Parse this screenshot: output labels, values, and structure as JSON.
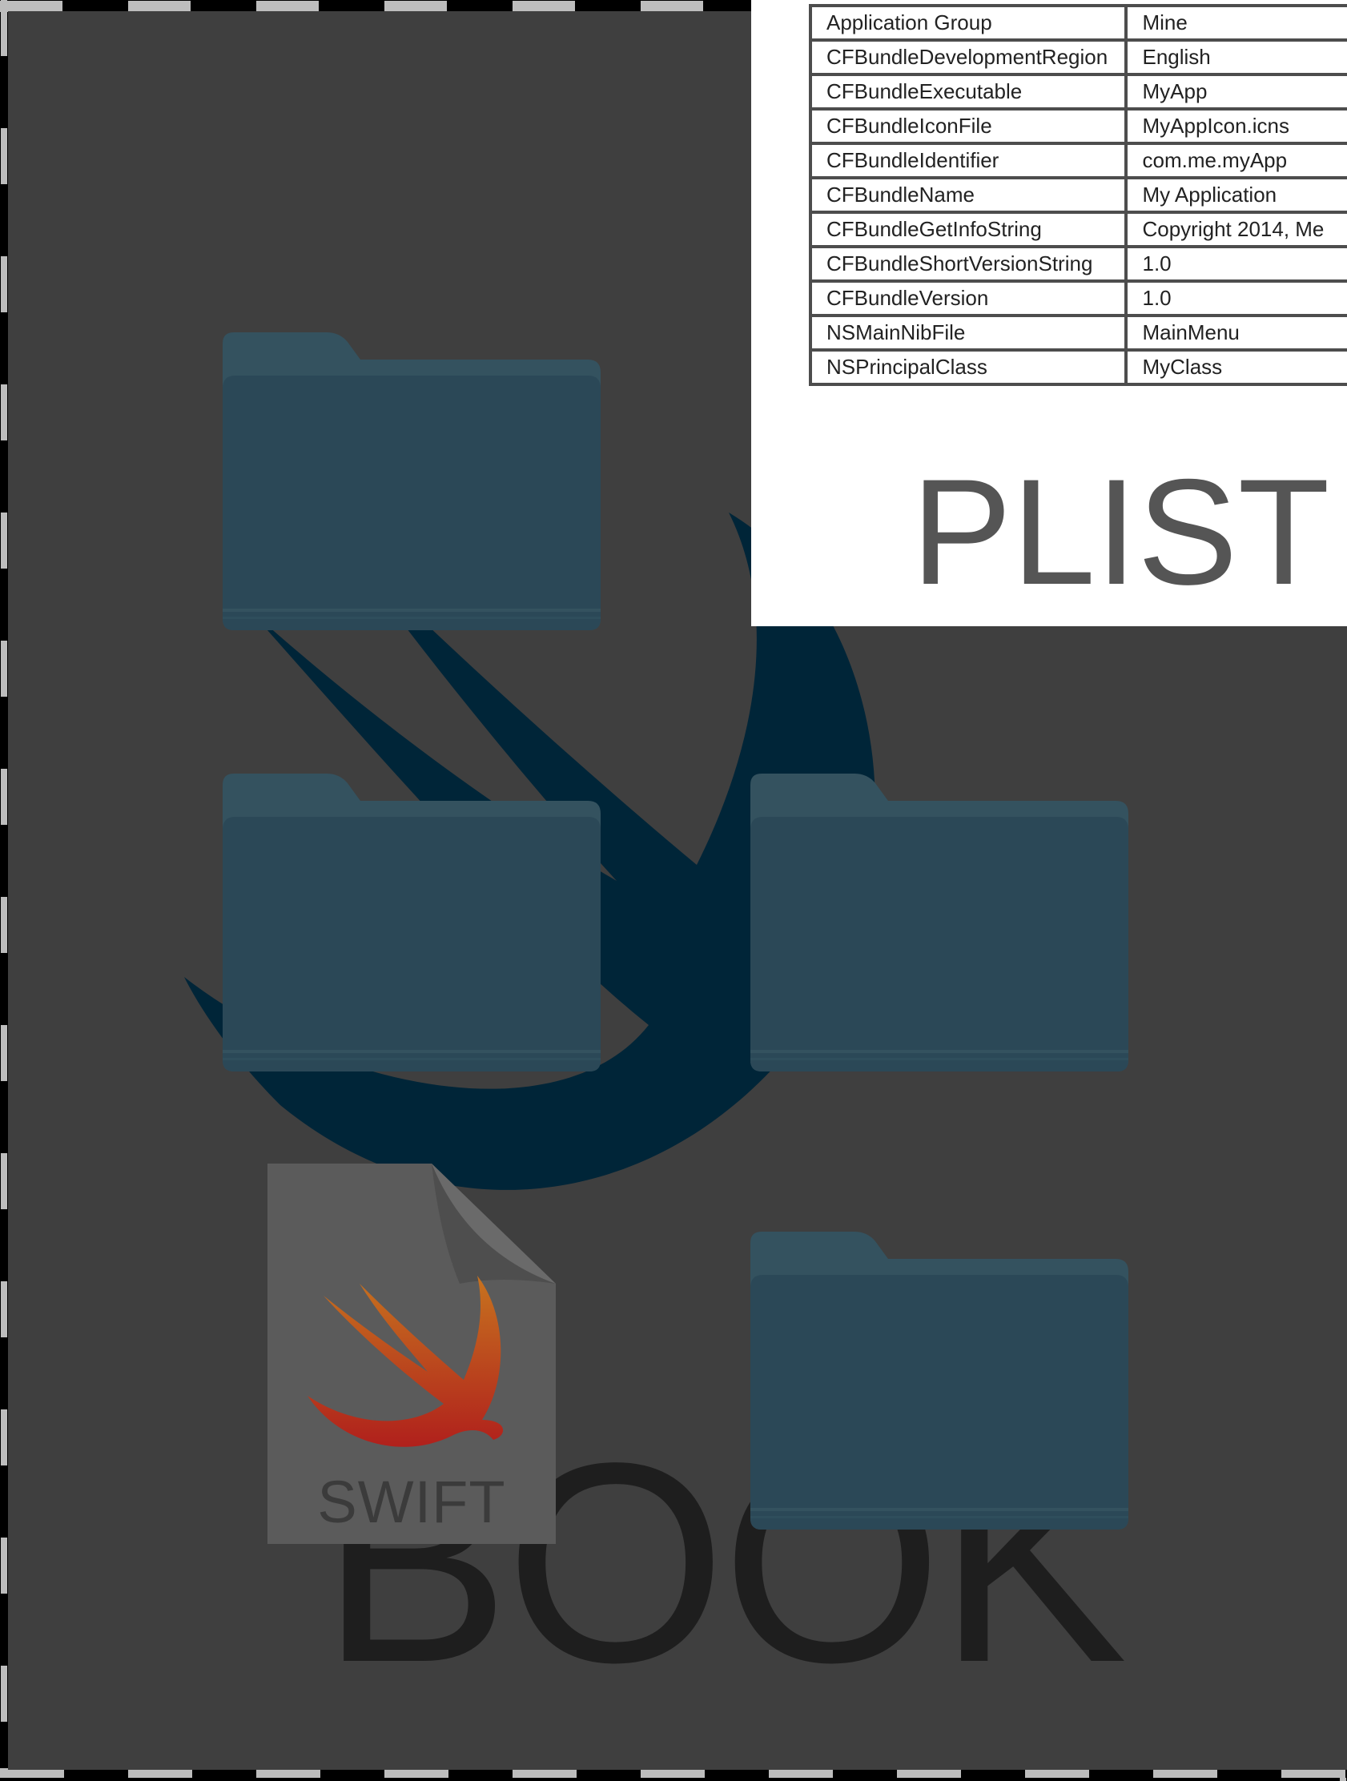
{
  "plist": {
    "rows": [
      {
        "key": "Application Group",
        "value": "Mine"
      },
      {
        "key": "CFBundleDevelopmentRegion",
        "value": "English"
      },
      {
        "key": "CFBundleExecutable",
        "value": "MyApp"
      },
      {
        "key": "CFBundleIconFile",
        "value": "MyAppIcon.icns"
      },
      {
        "key": "CFBundleIdentifier",
        "value": "com.me.myApp"
      },
      {
        "key": "CFBundleName",
        "value": "My Application"
      },
      {
        "key": "CFBundleGetInfoString",
        "value": "Copyright 2014, Me"
      },
      {
        "key": "CFBundleShortVersionString",
        "value": "1.0"
      },
      {
        "key": "CFBundleVersion",
        "value": "1.0"
      },
      {
        "key": "NSMainNibFile",
        "value": "MainMenu"
      },
      {
        "key": "NSPrincipalClass",
        "value": "MyClass"
      }
    ],
    "title": "PLIST"
  },
  "swift_file": {
    "label": "SWIFT",
    "icon": "swift-logo-icon"
  },
  "book_label": "BOOK",
  "folders": [
    {
      "icon": "folder-icon"
    },
    {
      "icon": "folder-icon"
    },
    {
      "icon": "folder-icon"
    },
    {
      "icon": "folder-icon"
    }
  ],
  "colors": {
    "background": "#3f3f3f",
    "folder": "#2b4857",
    "swift_bird": "#002538",
    "plist_panel": "#ffffff"
  }
}
